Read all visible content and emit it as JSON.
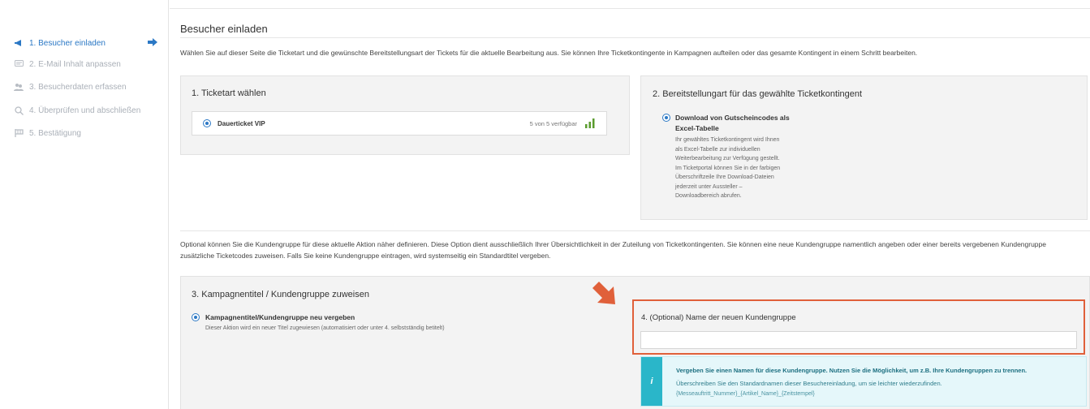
{
  "sidebar": {
    "items": [
      {
        "label": "1. Besucher einladen",
        "icon": "megaphone-icon"
      },
      {
        "label": "2. E-Mail Inhalt anpassen",
        "icon": "message-icon"
      },
      {
        "label": "3. Besucherdaten erfassen",
        "icon": "users-icon"
      },
      {
        "label": "4. Überprüfen und abschließen",
        "icon": "search-icon"
      },
      {
        "label": "5. Bestätigung",
        "icon": "flag-icon"
      }
    ]
  },
  "page": {
    "title": "Besucher einladen",
    "intro": "Wählen Sie auf dieser Seite die Ticketart und die gewünschte Bereitstellungsart der Tickets für die aktuelle Bearbeitung aus. Sie können Ihre Ticketkontingente in Kampagnen aufteilen oder das gesamte Kontingent in einem Schritt bearbeiten."
  },
  "ticket": {
    "title": "1. Ticketart wählen",
    "option_label": "Dauerticket VIP",
    "availability": "5 von 5 verfügbar"
  },
  "delivery": {
    "title": "2. Bereitstellungart für das gewählte Ticketkontingent",
    "option_label_line1": "Download von Gutscheincodes als",
    "option_label_line2": "Excel-Tabelle",
    "desc_lines": [
      "Ihr gewähltes Ticketkontingent wird Ihnen",
      "als Excel-Tabelle zur individuellen",
      "Weiterbearbeitung zur Verfügung gestellt.",
      "Im Ticketportal können Sie in der farbigen",
      "Überschriftzeile Ihre Download-Dateien",
      "jederzeit unter Aussteller –",
      "Downloadbereich abrufen."
    ]
  },
  "group_note": {
    "line1": "Optional können Sie die Kundengruppe für diese aktuelle Aktion näher definieren. Diese Option dient ausschließlich Ihrer Übersichtlichkeit in der Zuteilung von Ticketkontingenten. Sie können eine neue Kundengruppe namentlich angeben oder einer bereits vergebenen Kundengruppe",
    "line2": "zusätzliche Ticketcodes zuweisen. Falls Sie keine Kundengruppe eintragen, wird systemseitig ein Standardtitel vergeben."
  },
  "campaign": {
    "title": "3. Kampagnentitel / Kundengruppe zuweisen",
    "option_label": "Kampagnentitel/Kundengruppe neu vergeben",
    "option_desc": "Dieser Aktion wird ein neuer Titel zugewiesen (automatisiert oder unter 4. selbstständig betitelt)"
  },
  "new_group": {
    "label": "4. (Optional) Name der neuen Kundengruppe",
    "value": ""
  },
  "info_box": {
    "icon_text": "i",
    "heading": "Vergeben Sie einen Namen für diese Kundengruppe. Nutzen Sie die Möglichkeit, um z.B. Ihre Kundengruppen zu trennen.",
    "line1": "Überschreiben Sie den Standardnamen dieser Besuchereinladung, um sie leichter wiederzufinden.",
    "line2": "{Messeauftritt_Nummer}_{Artikel_Name}_{Zeitstempel}"
  },
  "colors": {
    "accent": "#2b78c5",
    "highlight": "#e0603a",
    "info": "#2ab6c9"
  }
}
